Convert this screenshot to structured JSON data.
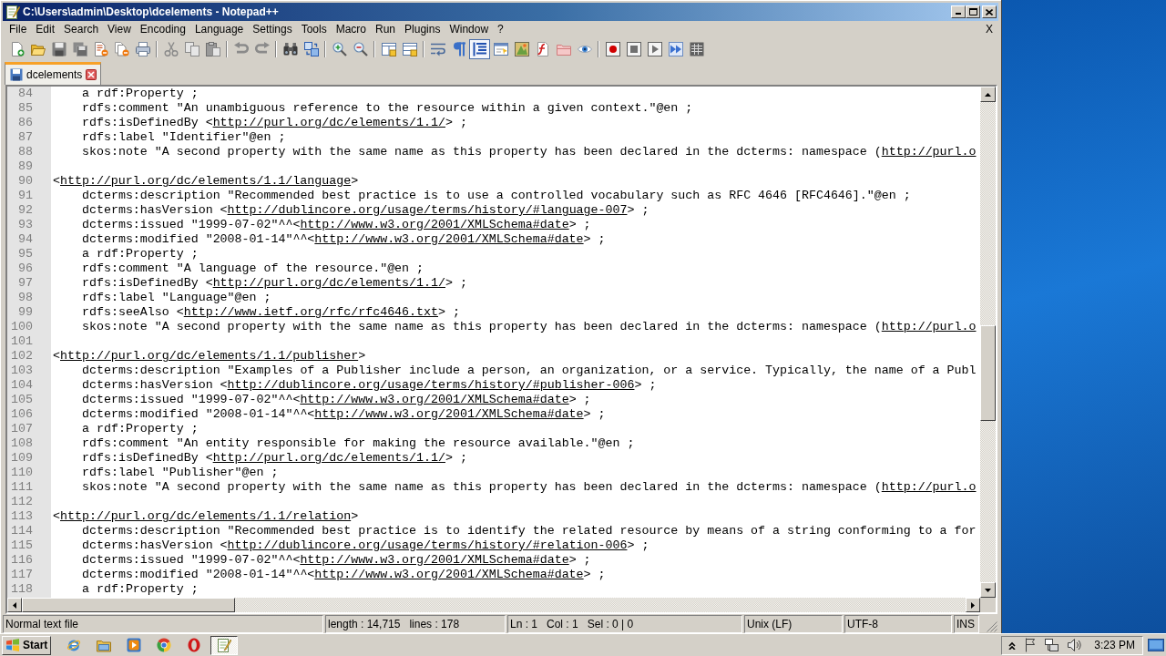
{
  "window": {
    "title": "C:\\Users\\admin\\Desktop\\dcelements - Notepad++"
  },
  "menu": {
    "items": [
      "File",
      "Edit",
      "Search",
      "View",
      "Encoding",
      "Language",
      "Settings",
      "Tools",
      "Macro",
      "Run",
      "Plugins",
      "Window",
      "?"
    ],
    "close_document": "X"
  },
  "toolbar": {
    "groups": [
      [
        {
          "kind": "new",
          "pressed": false
        },
        {
          "kind": "open",
          "pressed": false
        },
        {
          "kind": "save",
          "pressed": false
        },
        {
          "kind": "saveall",
          "pressed": false
        },
        {
          "kind": "close",
          "pressed": false
        },
        {
          "kind": "closeall",
          "pressed": false
        },
        {
          "kind": "print",
          "pressed": false
        }
      ],
      [
        {
          "kind": "cut",
          "pressed": false
        },
        {
          "kind": "copy",
          "pressed": false
        },
        {
          "kind": "paste",
          "pressed": false
        }
      ],
      [
        {
          "kind": "undo",
          "pressed": false
        },
        {
          "kind": "redo",
          "pressed": false
        }
      ],
      [
        {
          "kind": "find",
          "pressed": false
        },
        {
          "kind": "replace",
          "pressed": false
        }
      ],
      [
        {
          "kind": "zoomin",
          "pressed": false
        },
        {
          "kind": "zoomout",
          "pressed": false
        }
      ],
      [
        {
          "kind": "syncv",
          "pressed": false
        },
        {
          "kind": "synch",
          "pressed": false
        }
      ],
      [
        {
          "kind": "wrap",
          "pressed": false
        },
        {
          "kind": "allchars",
          "pressed": false
        },
        {
          "kind": "indent",
          "pressed": true
        },
        {
          "kind": "udl",
          "pressed": false
        },
        {
          "kind": "docmap",
          "pressed": false
        },
        {
          "kind": "funclist",
          "pressed": false
        },
        {
          "kind": "workspace",
          "pressed": false
        },
        {
          "kind": "monitor",
          "pressed": false
        }
      ],
      [
        {
          "kind": "record",
          "pressed": false
        },
        {
          "kind": "stop",
          "pressed": false
        },
        {
          "kind": "play",
          "pressed": false
        },
        {
          "kind": "playmulti",
          "pressed": false
        },
        {
          "kind": "savemacro",
          "pressed": false
        }
      ]
    ]
  },
  "tabs": [
    {
      "label": "dcelements",
      "selected": true
    }
  ],
  "editor": {
    "lines": [
      {
        "children": [
          {
            "number": "84",
            "segments": [
              {
                "kind": "code",
                "text": "a rdf:Property ;"
              }
            ]
          },
          {
            "number": "85",
            "segments": [
              {
                "kind": "code",
                "text": "rdfs:comment \"An unambiguous reference to the resource within a given context.\"@en ;"
              }
            ]
          },
          {
            "number": "86",
            "segments": [
              {
                "kind": "code",
                "text": "rdfs:isDefinedBy <"
              },
              {
                "kind": "link",
                "text": "http://purl.org/dc/elements/1.1/"
              },
              {
                "kind": "code",
                "text": "> ;"
              }
            ]
          },
          {
            "number": "87",
            "segments": [
              {
                "kind": "code",
                "text": "rdfs:label \"Identifier\"@en ;"
              }
            ]
          },
          {
            "number": "88",
            "segments": [
              {
                "kind": "code",
                "text": "skos:note \"A second property with the same name as this property has been declared in the dcterms: namespace ("
              },
              {
                "kind": "link",
                "text": "http://purl.o"
              }
            ]
          }
        ]
      },
      {
        "number": "89"
      },
      {
        "number": "90",
        "segments": [
          {
            "kind": "code",
            "text": "<"
          },
          {
            "kind": "link",
            "text": "http://purl.org/dc/elements/1.1/language"
          },
          {
            "kind": "code",
            "text": ">"
          }
        ],
        "children": [
          {
            "number": "91",
            "segments": [
              {
                "kind": "code",
                "text": "dcterms:description \"Recommended best practice is to use a controlled vocabulary such as RFC 4646 [RFC4646].\"@en ;"
              }
            ]
          },
          {
            "number": "92",
            "segments": [
              {
                "kind": "code",
                "text": "dcterms:hasVersion <"
              },
              {
                "kind": "link",
                "text": "http://dublincore.org/usage/terms/history/#language-007"
              },
              {
                "kind": "code",
                "text": "> ;"
              }
            ]
          },
          {
            "number": "93",
            "segments": [
              {
                "kind": "code",
                "text": "dcterms:issued \"1999-07-02\"^^<"
              },
              {
                "kind": "link",
                "text": "http://www.w3.org/2001/XMLSchema#date"
              },
              {
                "kind": "code",
                "text": "> ;"
              }
            ]
          },
          {
            "number": "94",
            "segments": [
              {
                "kind": "code",
                "text": "dcterms:modified \"2008-01-14\"^^<"
              },
              {
                "kind": "link",
                "text": "http://www.w3.org/2001/XMLSchema#date"
              },
              {
                "kind": "code",
                "text": "> ;"
              }
            ]
          },
          {
            "number": "95",
            "segments": [
              {
                "kind": "code",
                "text": "a rdf:Property ;"
              }
            ]
          },
          {
            "number": "96",
            "segments": [
              {
                "kind": "code",
                "text": "rdfs:comment \"A language of the resource.\"@en ;"
              }
            ]
          },
          {
            "number": "97",
            "segments": [
              {
                "kind": "code",
                "text": "rdfs:isDefinedBy <"
              },
              {
                "kind": "link",
                "text": "http://purl.org/dc/elements/1.1/"
              },
              {
                "kind": "code",
                "text": "> ;"
              }
            ]
          },
          {
            "number": "98",
            "segments": [
              {
                "kind": "code",
                "text": "rdfs:label \"Language\"@en ;"
              }
            ]
          },
          {
            "number": "99",
            "segments": [
              {
                "kind": "code",
                "text": "rdfs:seeAlso <"
              },
              {
                "kind": "link",
                "text": "http://www.ietf.org/rfc/rfc4646.txt"
              },
              {
                "kind": "code",
                "text": "> ;"
              }
            ]
          },
          {
            "number": "100",
            "segments": [
              {
                "kind": "code",
                "text": "skos:note \"A second property with the same name as this property has been declared in the dcterms: namespace ("
              },
              {
                "kind": "link",
                "text": "http://purl.o"
              }
            ]
          }
        ]
      },
      {
        "number": "101"
      },
      {
        "number": "102",
        "segments": [
          {
            "kind": "code",
            "text": "<"
          },
          {
            "kind": "link",
            "text": "http://purl.org/dc/elements/1.1/publisher"
          },
          {
            "kind": "code",
            "text": ">"
          }
        ],
        "children": [
          {
            "number": "103",
            "segments": [
              {
                "kind": "code",
                "text": "dcterms:description \"Examples of a Publisher include a person, an organization, or a service. Typically, the name of a Publ"
              }
            ]
          },
          {
            "number": "104",
            "segments": [
              {
                "kind": "code",
                "text": "dcterms:hasVersion <"
              },
              {
                "kind": "link",
                "text": "http://dublincore.org/usage/terms/history/#publisher-006"
              },
              {
                "kind": "code",
                "text": "> ;"
              }
            ]
          },
          {
            "number": "105",
            "segments": [
              {
                "kind": "code",
                "text": "dcterms:issued \"1999-07-02\"^^<"
              },
              {
                "kind": "link",
                "text": "http://www.w3.org/2001/XMLSchema#date"
              },
              {
                "kind": "code",
                "text": "> ;"
              }
            ]
          },
          {
            "number": "106",
            "segments": [
              {
                "kind": "code",
                "text": "dcterms:modified \"2008-01-14\"^^<"
              },
              {
                "kind": "link",
                "text": "http://www.w3.org/2001/XMLSchema#date"
              },
              {
                "kind": "code",
                "text": "> ;"
              }
            ]
          },
          {
            "number": "107",
            "segments": [
              {
                "kind": "code",
                "text": "a rdf:Property ;"
              }
            ]
          },
          {
            "number": "108",
            "segments": [
              {
                "kind": "code",
                "text": "rdfs:comment \"An entity responsible for making the resource available.\"@en ;"
              }
            ]
          },
          {
            "number": "109",
            "segments": [
              {
                "kind": "code",
                "text": "rdfs:isDefinedBy <"
              },
              {
                "kind": "link",
                "text": "http://purl.org/dc/elements/1.1/"
              },
              {
                "kind": "code",
                "text": "> ;"
              }
            ]
          },
          {
            "number": "110",
            "segments": [
              {
                "kind": "code",
                "text": "rdfs:label \"Publisher\"@en ;"
              }
            ]
          },
          {
            "number": "111",
            "segments": [
              {
                "kind": "code",
                "text": "skos:note \"A second property with the same name as this property has been declared in the dcterms: namespace ("
              },
              {
                "kind": "link",
                "text": "http://purl.o"
              }
            ]
          }
        ]
      },
      {
        "number": "112"
      },
      {
        "number": "113",
        "segments": [
          {
            "kind": "code",
            "text": "<"
          },
          {
            "kind": "link",
            "text": "http://purl.org/dc/elements/1.1/relation"
          },
          {
            "kind": "code",
            "text": ">"
          }
        ],
        "children": [
          {
            "number": "114",
            "segments": [
              {
                "kind": "code",
                "text": "dcterms:description \"Recommended best practice is to identify the related resource by means of a string conforming to a for"
              }
            ]
          },
          {
            "number": "115",
            "segments": [
              {
                "kind": "code",
                "text": "dcterms:hasVersion <"
              },
              {
                "kind": "link",
                "text": "http://dublincore.org/usage/terms/history/#relation-006"
              },
              {
                "kind": "code",
                "text": "> ;"
              }
            ]
          },
          {
            "number": "116",
            "segments": [
              {
                "kind": "code",
                "text": "dcterms:issued \"1999-07-02\"^^<"
              },
              {
                "kind": "link",
                "text": "http://www.w3.org/2001/XMLSchema#date"
              },
              {
                "kind": "code",
                "text": "> ;"
              }
            ]
          },
          {
            "number": "117",
            "segments": [
              {
                "kind": "code",
                "text": "dcterms:modified \"2008-01-14\"^^<"
              },
              {
                "kind": "link",
                "text": "http://www.w3.org/2001/XMLSchema#date"
              },
              {
                "kind": "code",
                "text": "> ;"
              }
            ]
          },
          {
            "number": "118",
            "segments": [
              {
                "kind": "code",
                "text": "a rdf:Property ;"
              }
            ]
          }
        ]
      }
    ]
  },
  "status_bar": {
    "file_type": "Normal text file",
    "length": "length : 14,715",
    "lines": "lines : 178",
    "line": "Ln : 1",
    "column": "Col : 1",
    "selection": "Sel : 0 | 0",
    "eol": "Unix (LF)",
    "encoding": "UTF-8",
    "mode": "INS"
  },
  "taskbar": {
    "start": "Start",
    "apps": [
      {
        "kind": "globe",
        "active": false
      },
      {
        "kind": "folder",
        "active": false
      },
      {
        "kind": "player",
        "active": false
      },
      {
        "kind": "ball",
        "active": false
      },
      {
        "kind": "ring",
        "active": false
      },
      {
        "kind": "notepad",
        "active": true
      }
    ],
    "clock": "3:23 PM"
  }
}
